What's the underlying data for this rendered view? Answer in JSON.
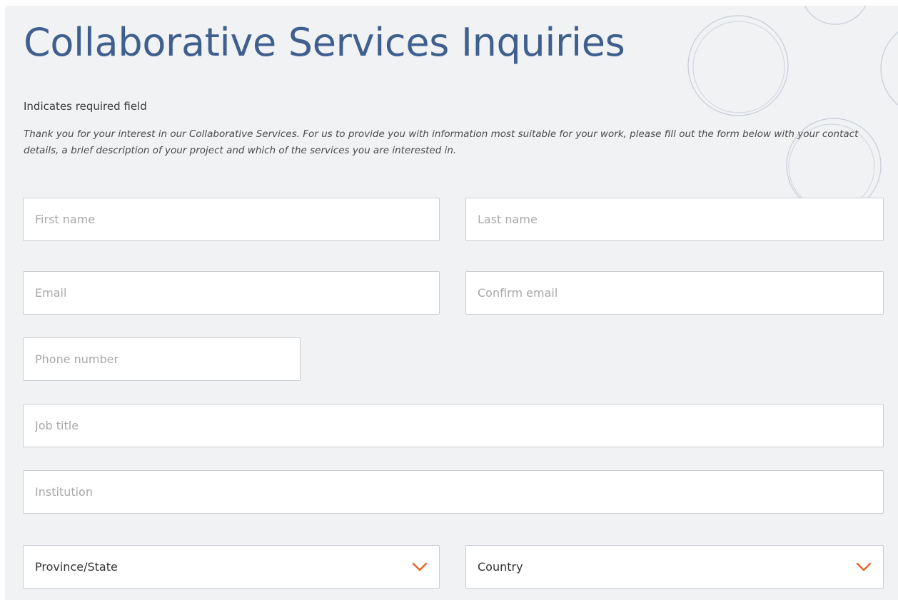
{
  "header": {
    "title": "Collaborative Services Inquiries",
    "required_note": "Indicates required field",
    "intro": "Thank you for your interest in our Collaborative Services. For us to provide you with information most suitable for your work, please fill out the form below with your contact details, a brief description of your project and which of the services you are interested in."
  },
  "form": {
    "first_name": {
      "placeholder": "First name",
      "value": ""
    },
    "last_name": {
      "placeholder": "Last name",
      "value": ""
    },
    "email": {
      "placeholder": "Email",
      "value": ""
    },
    "confirm_email": {
      "placeholder": "Confirm email",
      "value": ""
    },
    "phone": {
      "placeholder": "Phone number",
      "value": ""
    },
    "job_title": {
      "placeholder": "Job title",
      "value": ""
    },
    "institution": {
      "placeholder": "Institution",
      "value": ""
    },
    "province": {
      "selected": "Province/State",
      "icon": "chevron-down-icon"
    },
    "country": {
      "selected": "Country",
      "icon": "chevron-down-icon"
    }
  },
  "colors": {
    "title": "#3f5f8e",
    "accent_chevron": "#e8622a",
    "background": "#f1f2f4",
    "field_border": "#c9cdd2"
  }
}
